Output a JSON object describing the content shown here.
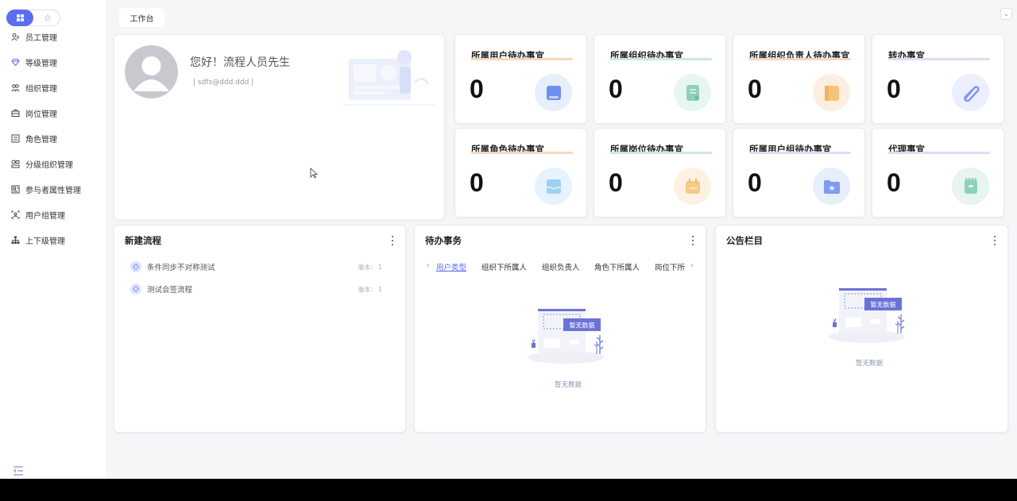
{
  "sidebar": {
    "items": [
      {
        "label": "员工管理",
        "icon": "users-icon"
      },
      {
        "label": "等级管理",
        "icon": "diamond-icon"
      },
      {
        "label": "组织管理",
        "icon": "org-icon"
      },
      {
        "label": "岗位管理",
        "icon": "briefcase-icon"
      },
      {
        "label": "角色管理",
        "icon": "role-icon"
      },
      {
        "label": "分级组织管理",
        "icon": "hierarchy-icon"
      },
      {
        "label": "参与者属性管理",
        "icon": "id-card-icon"
      },
      {
        "label": "用户组管理",
        "icon": "user-group-icon"
      },
      {
        "label": "上下级管理",
        "icon": "tree-icon"
      }
    ]
  },
  "tabs": {
    "current": "工作台"
  },
  "profile": {
    "greeting": "您好！流程人员先生",
    "email": "| sdfs@ddd.ddd |"
  },
  "stats": [
    {
      "title": "所属用户待办事宜",
      "value": "0",
      "accent": "#f7c8a0",
      "icon_bg": "#e7eefc",
      "icon_color": "#6f8ef0"
    },
    {
      "title": "所属组织待办事宜",
      "value": "0",
      "accent": "#bfe2da",
      "icon_bg": "#e6f6f1",
      "icon_color": "#7ccbb4"
    },
    {
      "title": "所属组织负责人待办事宜",
      "value": "0",
      "accent": "#f5c9a8",
      "icon_bg": "#fdeee2",
      "icon_color": "#f6c27a"
    },
    {
      "title": "转办事宜",
      "value": "0",
      "accent": "#c9d8ee",
      "icon_bg": "#eceffd",
      "icon_color": "#8495ef"
    },
    {
      "title": "所属角色待办事宜",
      "value": "0",
      "accent": "#f7c8a0",
      "icon_bg": "#e6f3fc",
      "icon_color": "#8cc8ef"
    },
    {
      "title": "所属岗位待办事宜",
      "value": "0",
      "accent": "#bfe2da",
      "icon_bg": "#fdf1e4",
      "icon_color": "#f6c989"
    },
    {
      "title": "所属用户组待办事宜",
      "value": "0",
      "accent": "#c9d8ee",
      "icon_bg": "#e7eefc",
      "icon_color": "#7f9af0"
    },
    {
      "title": "代理事宜",
      "value": "0",
      "accent": "#c9d8ee",
      "icon_bg": "#e7f4f0",
      "icon_color": "#8ad2bd"
    }
  ],
  "new_flow": {
    "title": "新建流程",
    "items": [
      {
        "name": "条件同步不对称测试",
        "version": "版本： 1"
      },
      {
        "name": "测试会签流程",
        "version": "版本： 1"
      }
    ]
  },
  "todo": {
    "title": "待办事务",
    "tabs": [
      "用户类型",
      "组织下所属人",
      "组织负责人",
      "角色下所属人",
      "岗位下所"
    ],
    "empty_badge": "暂无数据",
    "empty_text": "暂无数据"
  },
  "notice": {
    "title": "公告栏目",
    "empty_badge": "暂无数据",
    "empty_text": "暂无数据"
  },
  "colors": {
    "primary": "#5b6ef0",
    "illustration": "#6b72d6"
  }
}
